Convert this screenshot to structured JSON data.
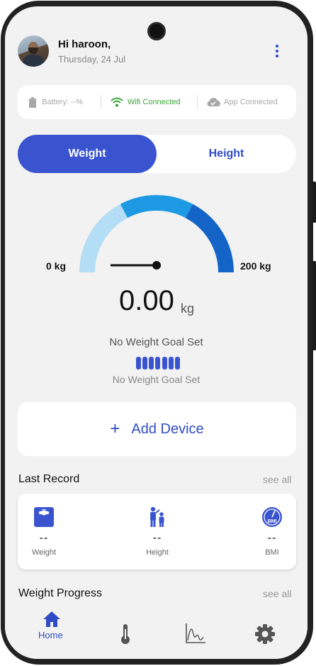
{
  "header": {
    "greeting": "Hi haroon,",
    "date": "Thursday, 24 Jul"
  },
  "status": {
    "battery": "Battery: --%",
    "wifi": "Wifi Connected",
    "app": "App Connected",
    "colors": {
      "battery": "#a8a8a8",
      "wifi": "#3aa43a",
      "app": "#a8a8a8"
    }
  },
  "tabs": {
    "weight": "Weight",
    "height": "Height",
    "active": "weight"
  },
  "gauge": {
    "min_label": "0 kg",
    "max_label": "200 kg",
    "value": "0.00",
    "unit": "kg",
    "segment_colors": [
      "#b3def6",
      "#1e9ae4",
      "#1463c6"
    ]
  },
  "goal": {
    "title": "No Weight Goal Set",
    "subtitle": "No Weight Goal Set"
  },
  "add_device": {
    "label": "Add Device"
  },
  "last_record": {
    "title": "Last Record",
    "see_all": "see all",
    "items": [
      {
        "icon": "scale-icon",
        "value": "--",
        "label": "Weight"
      },
      {
        "icon": "height-people-icon",
        "value": "--",
        "label": "Height"
      },
      {
        "icon": "bmi-gauge-icon",
        "value": "--",
        "label": "BMI"
      }
    ]
  },
  "weight_progress": {
    "title": "Weight Progress",
    "see_all": "see all"
  },
  "nav": {
    "items": [
      {
        "icon": "home-icon",
        "label": "Home",
        "active": true
      },
      {
        "icon": "thermometer-icon",
        "label": ""
      },
      {
        "icon": "chart-icon",
        "label": ""
      },
      {
        "icon": "gear-icon",
        "label": ""
      }
    ],
    "accent": "#2f4cc4"
  }
}
